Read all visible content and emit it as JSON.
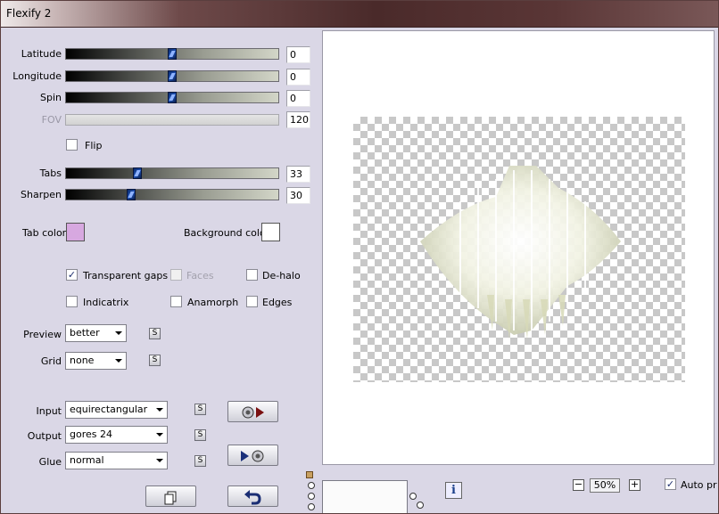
{
  "window": {
    "title": "Flexify 2"
  },
  "sliders": [
    {
      "label": "Latitude",
      "value": "0",
      "position": 0.5,
      "disabled": false
    },
    {
      "label": "Longitude",
      "value": "0",
      "position": 0.5,
      "disabled": false
    },
    {
      "label": "Spin",
      "value": "0",
      "position": 0.5,
      "disabled": false
    },
    {
      "label": "FOV",
      "value": "120",
      "position": null,
      "disabled": true
    },
    {
      "label": "Tabs",
      "value": "33",
      "position": 0.33,
      "disabled": false
    },
    {
      "label": "Sharpen",
      "value": "30",
      "position": 0.3,
      "disabled": false
    }
  ],
  "flip": {
    "label": "Flip",
    "checked": false
  },
  "tab_color": {
    "label": "Tab color",
    "color": "#d7a8e0"
  },
  "background_color": {
    "label": "Background color",
    "color": "#ffffff"
  },
  "options": {
    "transparent_gaps": {
      "label": "Transparent gaps",
      "checked": true
    },
    "faces": {
      "label": "Faces",
      "checked": false,
      "disabled": true
    },
    "de_halo": {
      "label": "De-halo",
      "checked": false
    },
    "indicatrix": {
      "label": "Indicatrix",
      "checked": false
    },
    "anamorph": {
      "label": "Anamorph",
      "checked": false
    },
    "edges": {
      "label": "Edges",
      "checked": false
    }
  },
  "preview": {
    "label": "Preview",
    "value": "better"
  },
  "grid": {
    "label": "Grid",
    "value": "none"
  },
  "input": {
    "label": "Input",
    "value": "equirectangular"
  },
  "output": {
    "label": "Output",
    "value": "gores 24"
  },
  "glue": {
    "label": "Glue",
    "value": "normal"
  },
  "zoom": {
    "value": "50%",
    "minus": "−",
    "plus": "+"
  },
  "auto_preview": {
    "label": "Auto pr",
    "checked": true
  },
  "icons": {
    "s_button": "S",
    "info": "i",
    "copy": "copy-icon",
    "undo": "undo-icon"
  },
  "colors": {
    "accent_thumb": "#1c4fb3",
    "preview_shape": "#e8ead2"
  }
}
